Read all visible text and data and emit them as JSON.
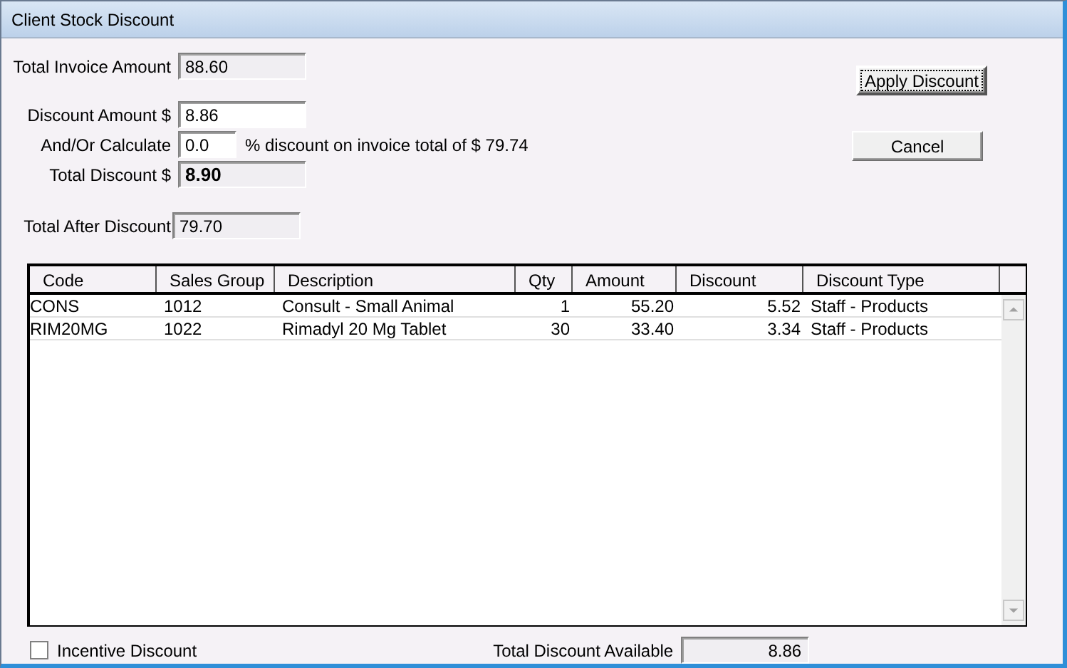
{
  "window": {
    "title": "Client Stock Discount"
  },
  "form": [
    {
      "kind": "readonly",
      "label": "Total Invoice Amount",
      "value": "88.60"
    },
    {
      "kind": "input",
      "label": "Discount Amount $",
      "value": "8.86"
    },
    {
      "kind": "short_input",
      "label": "And/Or Calculate",
      "value": "0.0",
      "suffix": "% discount on invoice total of $ 79.74"
    },
    {
      "kind": "readonly_bold",
      "label": "Total Discount $",
      "value": "8.90"
    },
    {
      "kind": "readonly_gap",
      "label": "Total After Discount",
      "value": "79.70"
    }
  ],
  "buttons": [
    {
      "label": "Apply Discount",
      "default": true
    },
    {
      "label": "Cancel",
      "default": false
    }
  ],
  "table": {
    "columns": [
      "Code",
      "Sales Group",
      "Description",
      "Qty",
      "Amount",
      "Discount",
      "Discount Type"
    ],
    "rows": [
      [
        "CONS",
        "1012",
        "Consult - Small Animal",
        "1",
        "55.20",
        "5.52",
        "Staff - Products"
      ],
      [
        "RIM20MG",
        "1022",
        "Rimadyl 20 Mg Tablet",
        "30",
        "33.40",
        "3.34",
        "Staff - Products"
      ]
    ]
  },
  "incentive": {
    "label": "Incentive Discount",
    "checked": false
  },
  "total_available": {
    "label": "Total Discount Available",
    "value": "8.86"
  }
}
